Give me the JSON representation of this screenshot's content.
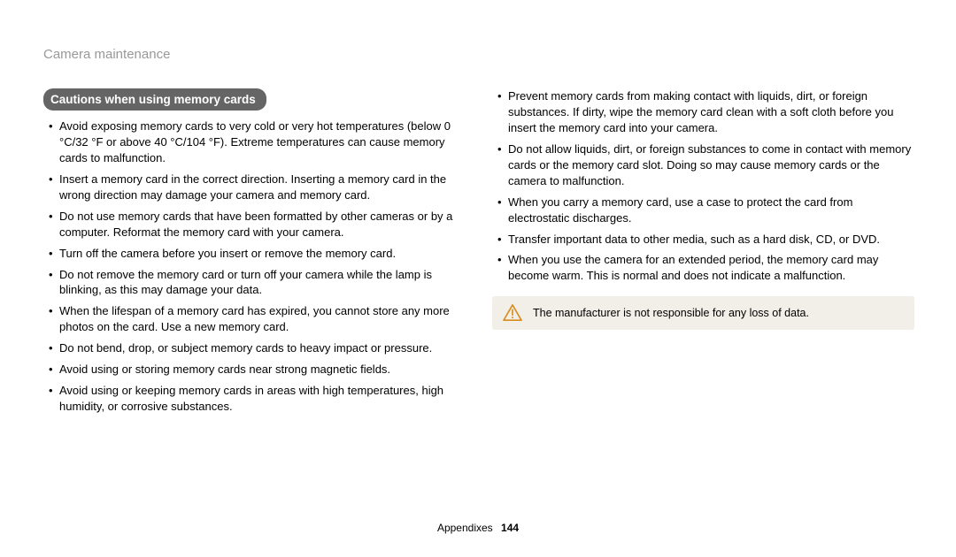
{
  "section_header": "Camera maintenance",
  "heading": "Cautions when using memory cards",
  "left_bullets": [
    "Avoid exposing memory cards to very cold or very hot temperatures (below 0 °C/32 °F or above 40 °C/104 °F). Extreme temperatures can cause memory cards to malfunction.",
    "Insert a memory card in the correct direction. Inserting a memory card in the wrong direction may damage your camera and memory card.",
    "Do not use memory cards that have been formatted by other cameras or by a computer. Reformat the memory card with your camera.",
    "Turn off the camera before you insert or remove the memory card.",
    "Do not remove the memory card or turn off your camera while the lamp is blinking, as this may damage your data.",
    "When the lifespan of a memory card has expired, you cannot store any more photos on the card. Use a new memory card.",
    "Do not bend, drop, or subject memory cards to heavy impact or pressure.",
    "Avoid using or storing memory cards near strong magnetic fields.",
    "Avoid using or keeping memory cards in areas with high temperatures, high humidity, or corrosive substances."
  ],
  "right_bullets": [
    "Prevent memory cards from making contact with liquids, dirt, or foreign substances. If dirty, wipe the memory card clean with a soft cloth before you insert the memory card into your camera.",
    "Do not allow liquids, dirt, or foreign substances to come in contact with memory cards or the memory card slot. Doing so may cause memory cards or the camera to malfunction.",
    "When you carry a memory card, use a case to protect the card from electrostatic discharges.",
    "Transfer important data to other media, such as a hard disk, CD, or DVD.",
    "When you use the camera for an extended period, the memory card may become warm. This is normal and does not indicate a malfunction."
  ],
  "note_text": "The manufacturer is not responsible for any loss of data.",
  "footer": {
    "label": "Appendixes",
    "page": "144"
  }
}
